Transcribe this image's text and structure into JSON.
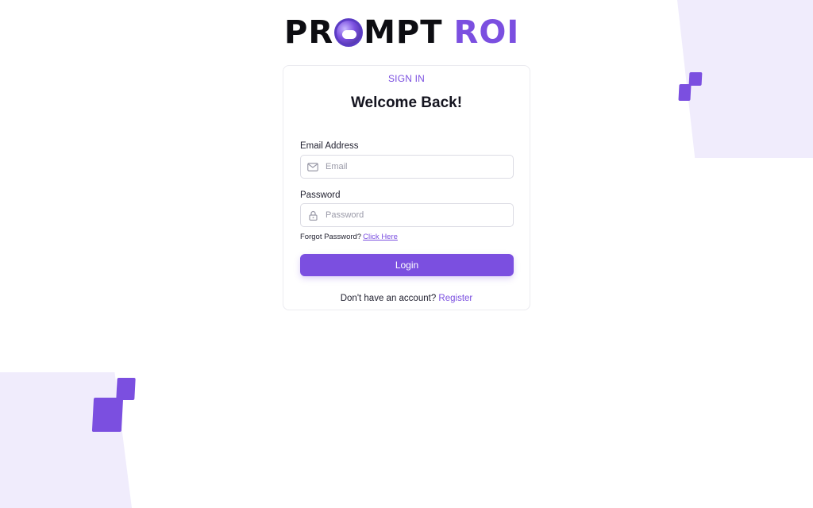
{
  "brand": {
    "logo_part_1": "PR",
    "logo_part_2": "MPT",
    "logo_part_3": "ROI",
    "accent_color": "#7b4fe0"
  },
  "card": {
    "eyebrow": "SIGN IN",
    "heading": "Welcome Back!"
  },
  "email": {
    "label": "Email Address",
    "placeholder": "Email",
    "value": "",
    "icon": "mail-icon"
  },
  "password": {
    "label": "Password",
    "placeholder": "Password",
    "value": "",
    "icon": "lock-icon"
  },
  "forgot": {
    "text": "Forgot Password?",
    "link": "Click Here"
  },
  "login": {
    "label": "Login"
  },
  "register": {
    "text": "Don't have an account?",
    "link": "Register"
  }
}
